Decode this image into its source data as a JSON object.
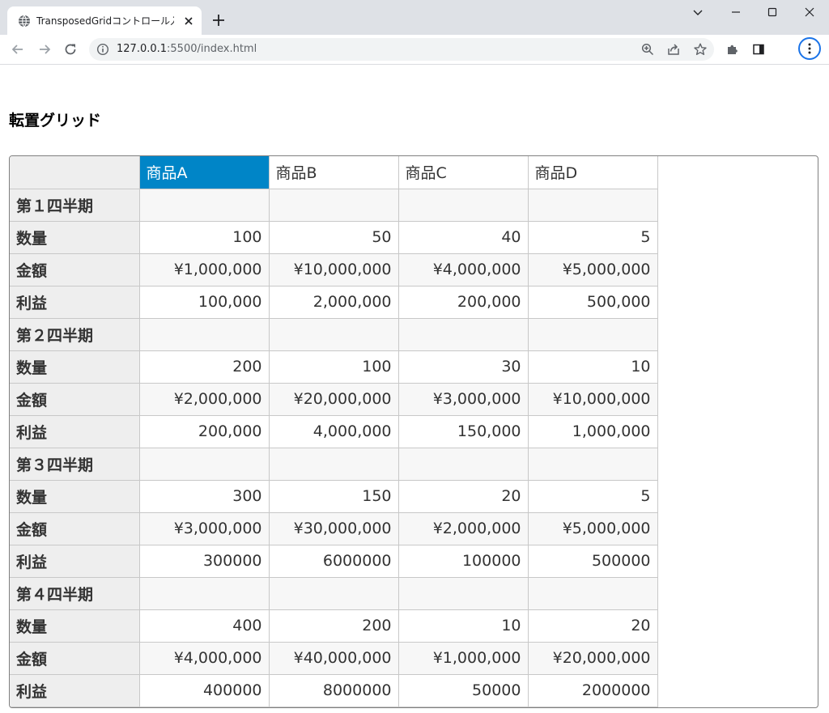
{
  "browser": {
    "tab_title": "TransposedGridコントロール入門",
    "url_host": "127.0.0.1",
    "url_path": ":5500/index.html"
  },
  "page": {
    "title": "転置グリッド"
  },
  "grid": {
    "columns": [
      "商品A",
      "商品B",
      "商品C",
      "商品D"
    ],
    "rows": [
      {
        "kind": "group",
        "label": "第１四半期",
        "values": [
          "",
          "",
          "",
          ""
        ]
      },
      {
        "kind": "plain",
        "label": "数量",
        "values": [
          "100",
          "50",
          "40",
          "5"
        ]
      },
      {
        "kind": "alt",
        "label": "金額",
        "values": [
          "¥1,000,000",
          "¥10,000,000",
          "¥4,000,000",
          "¥5,000,000"
        ]
      },
      {
        "kind": "plain",
        "label": "利益",
        "values": [
          "100,000",
          "2,000,000",
          "200,000",
          "500,000"
        ]
      },
      {
        "kind": "group",
        "label": "第２四半期",
        "values": [
          "",
          "",
          "",
          ""
        ]
      },
      {
        "kind": "plain",
        "label": "数量",
        "values": [
          "200",
          "100",
          "30",
          "10"
        ]
      },
      {
        "kind": "alt",
        "label": "金額",
        "values": [
          "¥2,000,000",
          "¥20,000,000",
          "¥3,000,000",
          "¥10,000,000"
        ]
      },
      {
        "kind": "plain",
        "label": "利益",
        "values": [
          "200,000",
          "4,000,000",
          "150,000",
          "1,000,000"
        ]
      },
      {
        "kind": "group",
        "label": "第３四半期",
        "values": [
          "",
          "",
          "",
          ""
        ]
      },
      {
        "kind": "plain",
        "label": "数量",
        "values": [
          "300",
          "150",
          "20",
          "5"
        ]
      },
      {
        "kind": "alt",
        "label": "金額",
        "values": [
          "¥3,000,000",
          "¥30,000,000",
          "¥2,000,000",
          "¥5,000,000"
        ]
      },
      {
        "kind": "plain",
        "label": "利益",
        "values": [
          "300000",
          "6000000",
          "100000",
          "500000"
        ]
      },
      {
        "kind": "group",
        "label": "第４四半期",
        "values": [
          "",
          "",
          "",
          ""
        ]
      },
      {
        "kind": "plain",
        "label": "数量",
        "values": [
          "400",
          "200",
          "10",
          "20"
        ]
      },
      {
        "kind": "alt",
        "label": "金額",
        "values": [
          "¥4,000,000",
          "¥40,000,000",
          "¥1,000,000",
          "¥20,000,000"
        ]
      },
      {
        "kind": "plain",
        "label": "利益",
        "values": [
          "400000",
          "8000000",
          "50000",
          "2000000"
        ]
      }
    ]
  },
  "colors": {
    "selected_header": "#0085c7",
    "row_header_bg": "#eeeeee",
    "alt_row_bg": "#f7f7f7"
  },
  "icons": {
    "favicon": "globe-icon",
    "tab_close": "close-icon",
    "new_tab": "plus-icon",
    "back": "back-arrow-icon",
    "forward": "forward-arrow-icon",
    "reload": "reload-icon",
    "site_info": "info-icon",
    "zoom": "zoom-icon",
    "share": "share-icon",
    "bookmark": "star-icon",
    "extensions": "puzzle-icon",
    "side_panel": "side-panel-icon",
    "menu": "kebab-menu-icon"
  }
}
